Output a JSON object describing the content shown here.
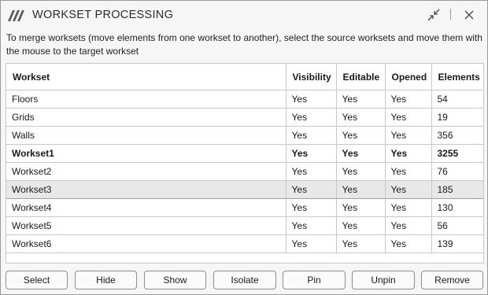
{
  "window": {
    "title": "WORKSET PROCESSING",
    "icons": {
      "logo": "app-logo",
      "collapse": "collapse-icon",
      "close": "close-icon"
    }
  },
  "description": "To merge worksets (move elements from one workset to another), select the source worksets and move them with the mouse to the target workset",
  "table": {
    "columns": [
      "Workset",
      "Visibility",
      "Editable",
      "Opened",
      "Elements"
    ],
    "rows": [
      [
        "Floors",
        "Yes",
        "Yes",
        "Yes",
        "54"
      ],
      [
        "Grids",
        "Yes",
        "Yes",
        "Yes",
        "19"
      ],
      [
        "Walls",
        "Yes",
        "Yes",
        "Yes",
        "356"
      ],
      [
        "Workset1",
        "Yes",
        "Yes",
        "Yes",
        "3255"
      ],
      [
        "Workset2",
        "Yes",
        "Yes",
        "Yes",
        "76"
      ],
      [
        "Workset3",
        "Yes",
        "Yes",
        "Yes",
        "185"
      ],
      [
        "Workset4",
        "Yes",
        "Yes",
        "Yes",
        "130"
      ],
      [
        "Workset5",
        "Yes",
        "Yes",
        "Yes",
        "56"
      ],
      [
        "Workset6",
        "Yes",
        "Yes",
        "Yes",
        "139"
      ]
    ],
    "bold_row": "Workset1",
    "selected_row": "Workset3"
  },
  "buttons": {
    "select": "Select",
    "hide": "Hide",
    "show": "Show",
    "isolate": "Isolate",
    "pin": "Pin",
    "unpin": "Unpin",
    "remove": "Remove"
  },
  "colors": {
    "window_bg": "#f6f6f6",
    "grid_bg": "#ffffff",
    "grid_line": "#c8c8c8",
    "selected_row_bg": "#e8e8e8",
    "logo": "#5b5b5b"
  }
}
